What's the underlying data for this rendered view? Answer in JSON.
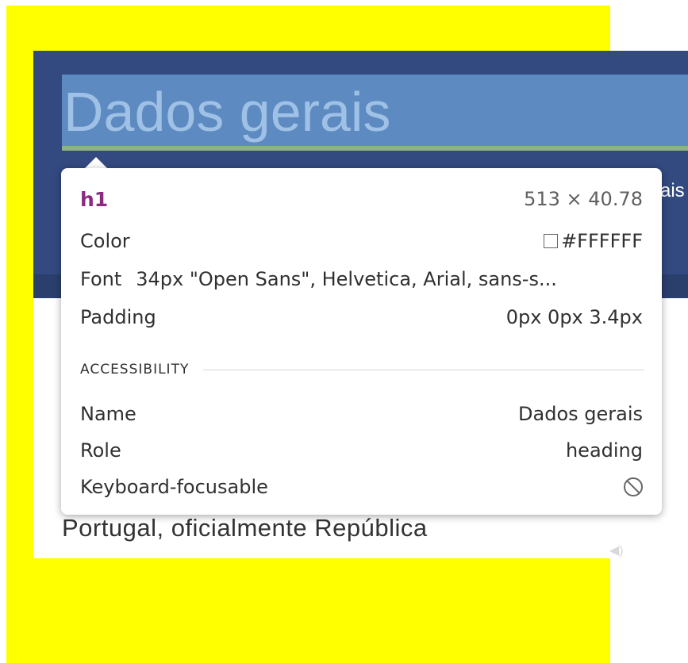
{
  "heading": {
    "text": "Dados gerais",
    "subtitle_peek": "ais"
  },
  "article": {
    "first_line": "Portugal, oficialmente República"
  },
  "inspector": {
    "tag": "h1",
    "size": "513 × 40.78",
    "color_label": "Color",
    "color_value": "#FFFFFF",
    "font_label": "Font",
    "font_value": "34px \"Open Sans\", Helvetica, Arial, sans-s...",
    "padding_label": "Padding",
    "padding_value": "0px 0px 3.4px",
    "accessibility_title": "ACCESSIBILITY",
    "name_label": "Name",
    "name_value": "Dados gerais",
    "role_label": "Role",
    "role_value": "heading",
    "focusable_label": "Keyboard-focusable",
    "focusable_icon": "not-allowed-icon"
  },
  "colors": {
    "outer_highlight": "#FFFF00",
    "banner": "#334A80",
    "content_highlight": "#5D8AC0",
    "padding_highlight": "#8FB18A",
    "tag": "#8A2B80"
  }
}
